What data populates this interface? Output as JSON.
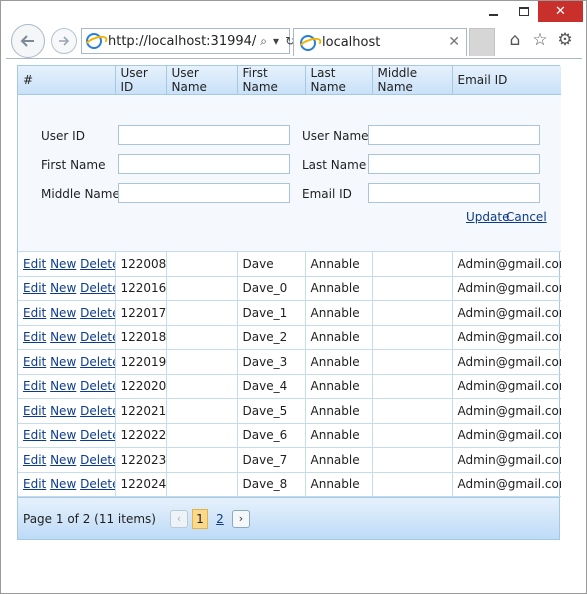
{
  "browser": {
    "url": "http://localhost:31994/",
    "tab_title": "localhost",
    "icons": [
      "back-arrow-icon",
      "forward-arrow-icon",
      "search-icon",
      "refresh-icon",
      "close-icon",
      "home-icon",
      "star-icon",
      "gear-icon"
    ]
  },
  "grid": {
    "columns": [
      "#",
      "User ID",
      "User Name",
      "First Name",
      "Last Name",
      "Middle Name",
      "Email ID"
    ],
    "edit_form": {
      "user_id_label": "User ID",
      "user_name_label": "User Name",
      "first_name_label": "First Name",
      "last_name_label": "Last Name",
      "middle_name_label": "Middle Name",
      "email_id_label": "Email ID",
      "update_label": "Update",
      "cancel_label": "Cancel"
    },
    "row_actions": {
      "edit": "Edit",
      "new": "New",
      "delete": "Delete"
    },
    "rows": [
      {
        "user_id": "122008",
        "user_name": "",
        "first_name": "Dave",
        "last_name": "Annable",
        "middle_name": "",
        "email": "Admin@gmail.com"
      },
      {
        "user_id": "122016",
        "user_name": "",
        "first_name": "Dave_0",
        "last_name": "Annable",
        "middle_name": "",
        "email": "Admin@gmail.com"
      },
      {
        "user_id": "122017",
        "user_name": "",
        "first_name": "Dave_1",
        "last_name": "Annable",
        "middle_name": "",
        "email": "Admin@gmail.com"
      },
      {
        "user_id": "122018",
        "user_name": "",
        "first_name": "Dave_2",
        "last_name": "Annable",
        "middle_name": "",
        "email": "Admin@gmail.com"
      },
      {
        "user_id": "122019",
        "user_name": "",
        "first_name": "Dave_3",
        "last_name": "Annable",
        "middle_name": "",
        "email": "Admin@gmail.com"
      },
      {
        "user_id": "122020",
        "user_name": "",
        "first_name": "Dave_4",
        "last_name": "Annable",
        "middle_name": "",
        "email": "Admin@gmail.com"
      },
      {
        "user_id": "122021",
        "user_name": "",
        "first_name": "Dave_5",
        "last_name": "Annable",
        "middle_name": "",
        "email": "Admin@gmail.com"
      },
      {
        "user_id": "122022",
        "user_name": "",
        "first_name": "Dave_6",
        "last_name": "Annable",
        "middle_name": "",
        "email": "Admin@gmail.com"
      },
      {
        "user_id": "122023",
        "user_name": "",
        "first_name": "Dave_7",
        "last_name": "Annable",
        "middle_name": "",
        "email": "Admin@gmail.com"
      },
      {
        "user_id": "122024",
        "user_name": "",
        "first_name": "Dave_8",
        "last_name": "Annable",
        "middle_name": "",
        "email": "Admin@gmail.com"
      }
    ],
    "pager": {
      "info": "Page 1 of 2 (11 items)",
      "pages": [
        "1",
        "2"
      ],
      "current_page": "1",
      "prev_symbol": "‹",
      "next_symbol": "›"
    }
  },
  "colors": {
    "header_gradient_top": "#e6f1fc",
    "header_gradient_bottom": "#c9e1f8",
    "grid_border": "#a6c9e2",
    "link": "#0b3b8c",
    "current_page_bg": "#fbd98a",
    "close_button": "#c9302c"
  }
}
